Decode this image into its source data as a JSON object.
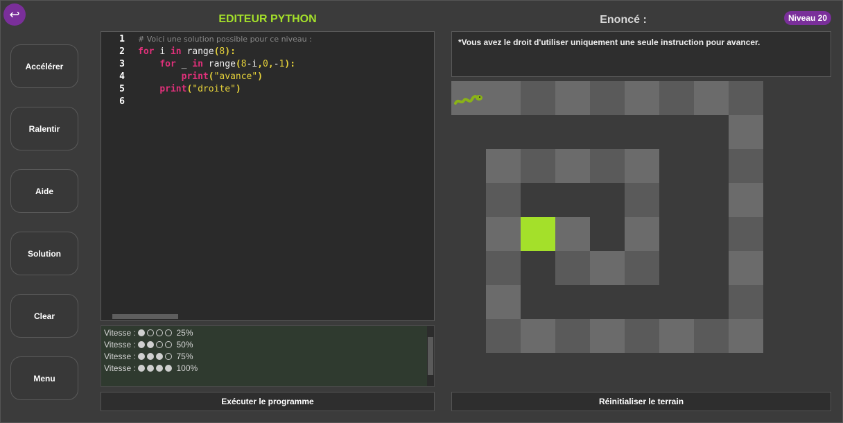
{
  "nav": {
    "back_icon": "back-arrow-icon"
  },
  "sidebar": {
    "buttons": [
      {
        "label": "Accélérer"
      },
      {
        "label": "Ralentir"
      },
      {
        "label": "Aide"
      },
      {
        "label": "Solution"
      },
      {
        "label": "Clear"
      },
      {
        "label": "Menu"
      }
    ]
  },
  "editor": {
    "title": "EDITEUR PYTHON",
    "lines": [
      {
        "number": "1",
        "text": "# Voici une solution possible pour ce niveau :"
      },
      {
        "number": "2",
        "text": "for i in range(8):"
      },
      {
        "number": "3",
        "text": "    for _ in range(8-i,0,-1):"
      },
      {
        "number": "4",
        "text": "        print(\"avance\")"
      },
      {
        "number": "5",
        "text": "    print(\"droite\")"
      },
      {
        "number": "6",
        "text": ""
      }
    ]
  },
  "console": {
    "lines": [
      {
        "label": "Vitesse :",
        "filled": 1,
        "total": 4,
        "value": "25%"
      },
      {
        "label": "Vitesse :",
        "filled": 2,
        "total": 4,
        "value": "50%"
      },
      {
        "label": "Vitesse :",
        "filled": 3,
        "total": 4,
        "value": "75%"
      },
      {
        "label": "Vitesse :",
        "filled": 4,
        "total": 4,
        "value": "100%"
      }
    ]
  },
  "actions": {
    "run_label": "Exécuter le programme",
    "reset_label": "Réinitialiser le terrain"
  },
  "enonce": {
    "title": "Enoncé :",
    "niveau": "Niveau 20",
    "text": "*Vous avez le droit d'utiliser uniquement une seule instruction pour avancer."
  },
  "terrain": {
    "cols": 9,
    "rows": 8,
    "colors": {
      "light": "#6b6b6b",
      "dark": "#5a5a5a",
      "goal": "#a4e02a",
      "snake": "#8ab317"
    },
    "snake": {
      "row": 0,
      "col": 0,
      "icon": "snake-icon"
    },
    "goal": {
      "row": 4,
      "col": 2
    },
    "path": [
      [
        0,
        1
      ],
      [
        0,
        2
      ],
      [
        0,
        3
      ],
      [
        0,
        4
      ],
      [
        0,
        5
      ],
      [
        0,
        6
      ],
      [
        0,
        7
      ],
      [
        0,
        8
      ],
      [
        1,
        8
      ],
      [
        2,
        8
      ],
      [
        3,
        8
      ],
      [
        4,
        8
      ],
      [
        5,
        8
      ],
      [
        6,
        8
      ],
      [
        7,
        8
      ],
      [
        7,
        7
      ],
      [
        7,
        6
      ],
      [
        7,
        5
      ],
      [
        7,
        4
      ],
      [
        7,
        3
      ],
      [
        7,
        2
      ],
      [
        7,
        1
      ],
      [
        6,
        1
      ],
      [
        5,
        1
      ],
      [
        4,
        1
      ],
      [
        3,
        1
      ],
      [
        2,
        1
      ],
      [
        2,
        2
      ],
      [
        2,
        3
      ],
      [
        2,
        4
      ],
      [
        2,
        5
      ],
      [
        3,
        5
      ],
      [
        4,
        5
      ],
      [
        5,
        5
      ],
      [
        5,
        4
      ],
      [
        5,
        3
      ],
      [
        4,
        3
      ]
    ]
  }
}
